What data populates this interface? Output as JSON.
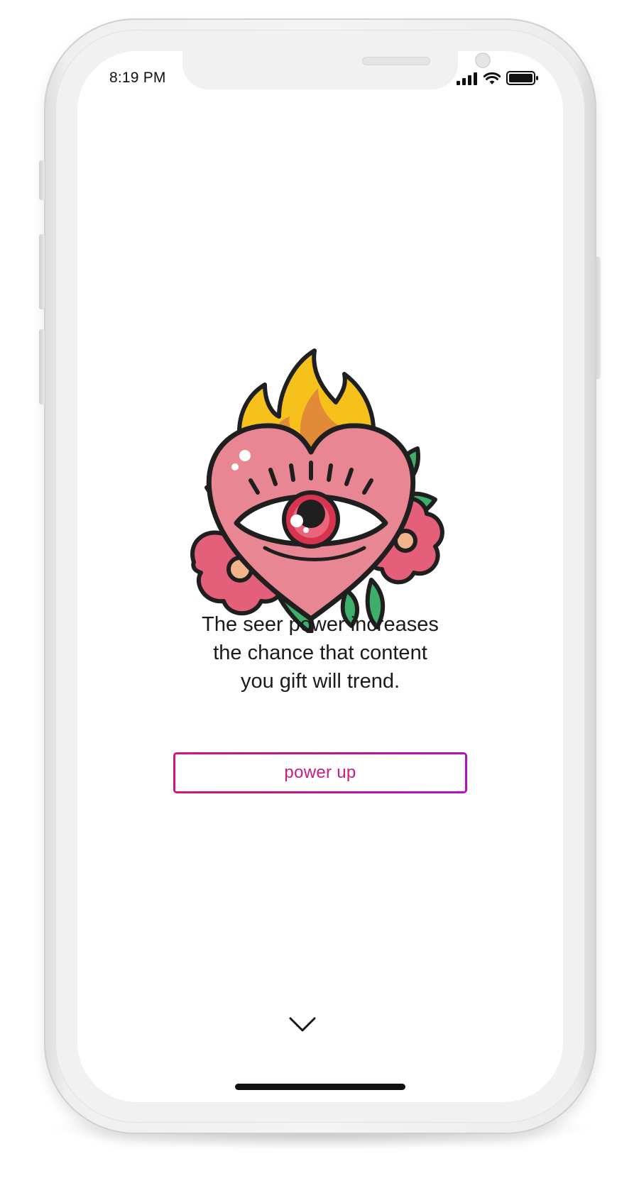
{
  "status_bar": {
    "time": "8:19 PM",
    "icons": [
      "cellular-signal-icon",
      "wifi-icon",
      "battery-icon"
    ]
  },
  "illustration": {
    "icon": "flaming-heart-eye-icon"
  },
  "message": {
    "line1": "The seer power increases",
    "line2": "the chance that content",
    "line3": "you gift will trend."
  },
  "cta": {
    "label": "power up"
  },
  "navigation": {
    "icon": "chevron-down-icon"
  },
  "colors": {
    "accent": "#cf1a7e",
    "accent_end": "#b312c4",
    "text": "#1a1a1a",
    "background": "#ffffff"
  }
}
